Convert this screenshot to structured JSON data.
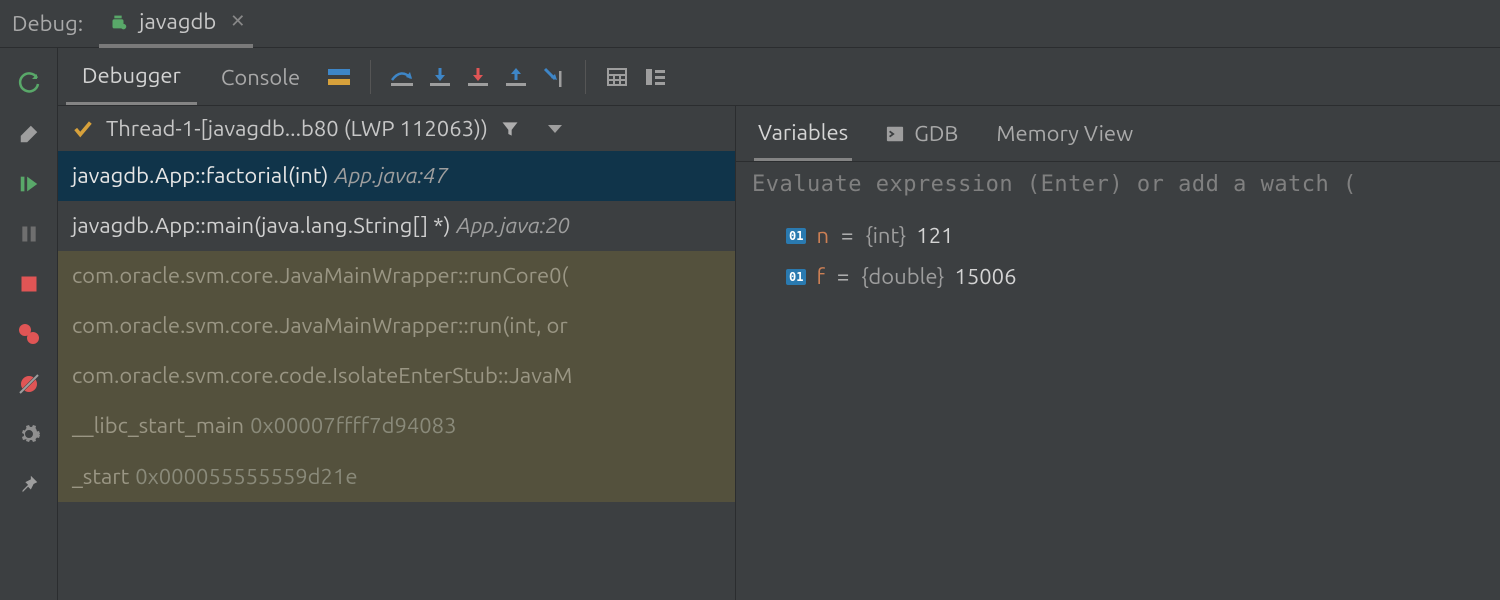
{
  "panel": {
    "title": "Debug:"
  },
  "runTab": {
    "label": "javagdb"
  },
  "toolbar": {
    "tabs": {
      "debugger": "Debugger",
      "console": "Console"
    }
  },
  "thread": {
    "label": "Thread-1-[javagdb...b80 (LWP 112063))"
  },
  "frames": [
    {
      "sig": "javagdb.App::factorial(int)",
      "loc": "App.java:47",
      "kind": "sel"
    },
    {
      "sig": "javagdb.App::main(java.lang.String[] *)",
      "loc": "App.java:20",
      "kind": "user"
    },
    {
      "sig": "com.oracle.svm.core.JavaMainWrapper::runCore0(",
      "loc": "",
      "kind": "lib"
    },
    {
      "sig": "com.oracle.svm.core.JavaMainWrapper::run(int, or",
      "loc": "",
      "kind": "lib"
    },
    {
      "sig": "com.oracle.svm.core.code.IsolateEnterStub::JavaM",
      "loc": "",
      "kind": "lib"
    },
    {
      "sig": "__libc_start_main",
      "addr": "0x00007ffff7d94083",
      "kind": "lib"
    },
    {
      "sig": "_start",
      "addr": "0x000055555559d21e",
      "kind": "lib"
    }
  ],
  "varsTabs": {
    "variables": "Variables",
    "gdb": "GDB",
    "memory": "Memory View"
  },
  "eval": {
    "placeholder": "Evaluate expression (Enter) or add a watch ("
  },
  "variables": [
    {
      "name": "n",
      "type": "{int}",
      "value": "121"
    },
    {
      "name": "f",
      "type": "{double}",
      "value": "15006"
    }
  ],
  "colors": {
    "accent": "#2a7ab0",
    "green": "#59a869",
    "red": "#e05555",
    "amber": "#d7a13b"
  }
}
